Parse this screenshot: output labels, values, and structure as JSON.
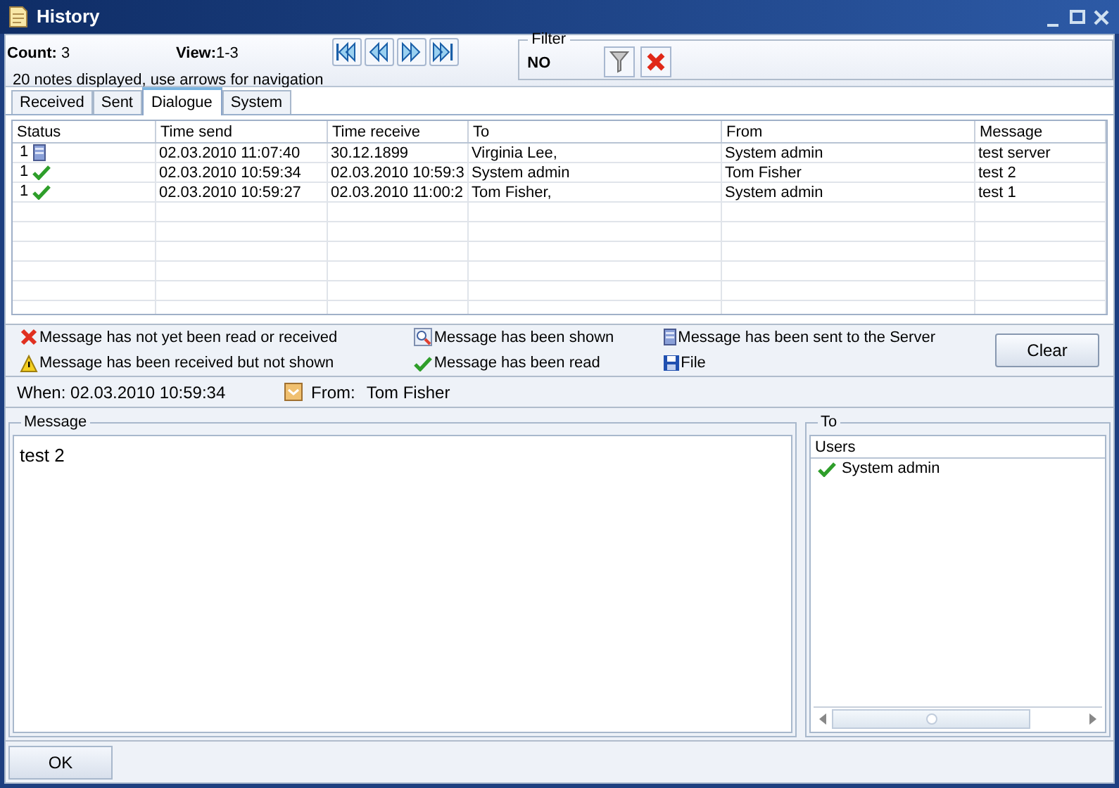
{
  "window": {
    "title": "History"
  },
  "header": {
    "count_label": "Count:",
    "count": "3",
    "view_label": "View:",
    "view": "1-3",
    "hint": "20 notes displayed, use arrows for navigation"
  },
  "nav_buttons": [
    {
      "kind": "first"
    },
    {
      "kind": "prev"
    },
    {
      "kind": "next"
    },
    {
      "kind": "last"
    }
  ],
  "filter": {
    "title": "Filter",
    "value": "NO"
  },
  "tabs": [
    {
      "label": "Received",
      "selected": false
    },
    {
      "label": "Sent",
      "selected": false
    },
    {
      "label": "Dialogue",
      "selected": true
    },
    {
      "label": "System",
      "selected": false
    }
  ],
  "table": {
    "columns": [
      "Status",
      "Time send",
      "Time receive",
      "To",
      "From",
      "Message"
    ],
    "rows": [
      {
        "status_count": "1",
        "kind": "server",
        "time_send": "02.03.2010 11:07:40",
        "time_receive": "30.12.1899",
        "to": "Virginia Lee,",
        "from": "System admin",
        "message": "test server"
      },
      {
        "status_count": "1",
        "kind": "read",
        "time_send": "02.03.2010 10:59:34",
        "time_receive": "02.03.2010 10:59:3",
        "to": "System admin",
        "from": "Tom Fisher",
        "message": "test 2"
      },
      {
        "status_count": "1",
        "kind": "read",
        "time_send": "02.03.2010 10:59:27",
        "time_receive": "02.03.2010 11:00:2",
        "to": "Tom Fisher,",
        "from": "System admin",
        "message": "test 1"
      }
    ]
  },
  "legend": [
    {
      "kind": "unread",
      "label": "Message has not yet been read or received"
    },
    {
      "kind": "warning",
      "label": "Message has been received but not shown"
    },
    {
      "kind": "shown",
      "label": "Message has been shown"
    },
    {
      "kind": "read",
      "label": "Message has been read"
    },
    {
      "kind": "server",
      "label": "Message has been sent to the Server"
    },
    {
      "kind": "file",
      "label": "File"
    }
  ],
  "clear_button": "Clear",
  "details": {
    "when": "When: 02.03.2010 10:59:34",
    "from_label": "From:",
    "from": "Tom Fisher"
  },
  "message_panel": {
    "title": "Message",
    "text": "test 2"
  },
  "to_panel": {
    "title": "To",
    "column": "Users",
    "users": [
      {
        "name": "System admin",
        "kind": "read"
      }
    ]
  },
  "ok_button": "OK"
}
